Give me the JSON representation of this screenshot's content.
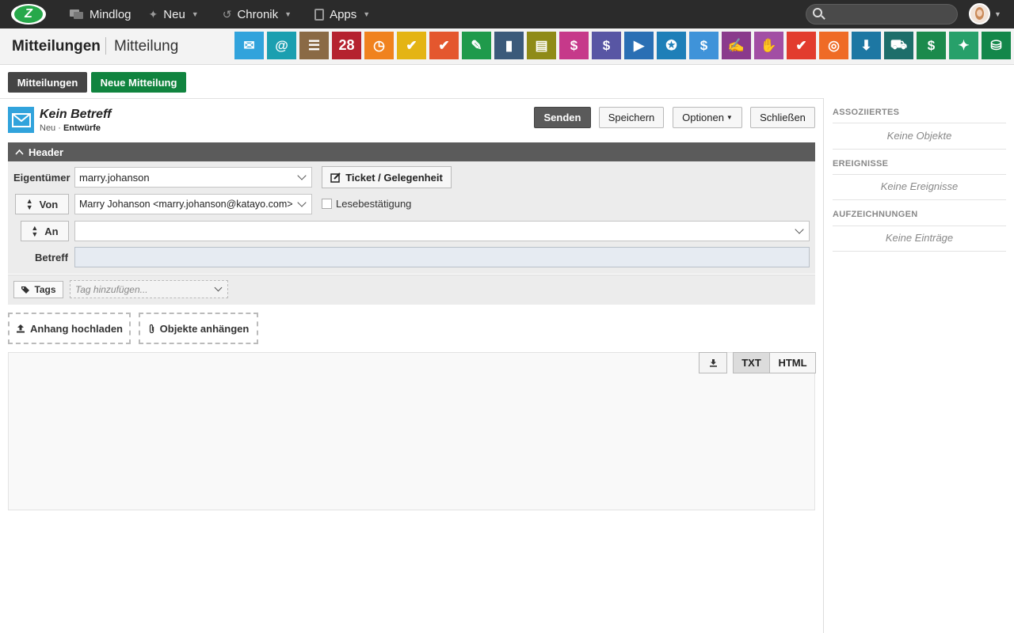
{
  "topnav": {
    "items": [
      {
        "label": "Mindlog",
        "icon": "chat-icon"
      },
      {
        "label": "Neu",
        "icon": "sparkle-icon"
      },
      {
        "label": "Chronik",
        "icon": "history-icon"
      },
      {
        "label": "Apps",
        "icon": "tablet-icon"
      }
    ],
    "search_placeholder": ""
  },
  "page": {
    "title": "Mitteilungen",
    "subtitle": "Mitteilung"
  },
  "app_icons": [
    {
      "name": "mail-app-icon",
      "color": "#31a3dc",
      "glyph": "✉"
    },
    {
      "name": "email-app-icon",
      "color": "#1b9fb0",
      "glyph": "@"
    },
    {
      "name": "contacts-app-icon",
      "color": "#8a6a45",
      "glyph": "☰"
    },
    {
      "name": "calendar-app-icon",
      "color": "#b5222f",
      "glyph": "28"
    },
    {
      "name": "timer-app-icon",
      "color": "#f0821e",
      "glyph": "◷"
    },
    {
      "name": "tasks-app-icon",
      "color": "#e4b414",
      "glyph": "✔"
    },
    {
      "name": "projects-app-icon",
      "color": "#e4572e",
      "glyph": "✔"
    },
    {
      "name": "notes-app-icon",
      "color": "#1f9a4b",
      "glyph": "✎"
    },
    {
      "name": "bookmarks-app-icon",
      "color": "#3b5a7a",
      "glyph": "▮"
    },
    {
      "name": "documents-app-icon",
      "color": "#8f8b17",
      "glyph": "▤"
    },
    {
      "name": "helpdesk-app-icon",
      "color": "#c6398a",
      "glyph": "$"
    },
    {
      "name": "finance-app-icon",
      "color": "#5856a4",
      "glyph": "$"
    },
    {
      "name": "delivery-app-icon",
      "color": "#2a6fb4",
      "glyph": "▶"
    },
    {
      "name": "support-app-icon",
      "color": "#1e7fb8",
      "glyph": "✪"
    },
    {
      "name": "budget-app-icon",
      "color": "#3f93d9",
      "glyph": "$"
    },
    {
      "name": "contracts-app-icon",
      "color": "#8a3a8c",
      "glyph": "✍"
    },
    {
      "name": "deals-app-icon",
      "color": "#a24ea4",
      "glyph": "✋"
    },
    {
      "name": "invoices-app-icon",
      "color": "#e23c2e",
      "glyph": "✔"
    },
    {
      "name": "campaign-app-icon",
      "color": "#ef6b26",
      "glyph": "◎"
    },
    {
      "name": "downloads-app-icon",
      "color": "#1d77a3",
      "glyph": "⬇"
    },
    {
      "name": "shop-app-icon",
      "color": "#1d6e6a",
      "glyph": "⛟"
    },
    {
      "name": "payments-app-icon",
      "color": "#1b8a4c",
      "glyph": "$"
    },
    {
      "name": "pricing-app-icon",
      "color": "#27a06a",
      "glyph": "✦"
    },
    {
      "name": "database-app-icon",
      "color": "#13874a",
      "glyph": "⛁"
    }
  ],
  "tabs": {
    "messages": "Mitteilungen",
    "new_message": "Neue Mitteilung"
  },
  "message": {
    "title": "Kein Betreff",
    "status_prefix": "Neu ·",
    "status_folder": "Entwürfe",
    "send": "Senden",
    "save": "Speichern",
    "options": "Optionen",
    "close": "Schließen"
  },
  "header_section": {
    "title": "Header",
    "owner_label": "Eigentümer",
    "owner_value": "marry.johanson",
    "ticket_button": "Ticket / Gelegenheit",
    "from_label": "Von",
    "from_value": "Marry Johanson <marry.johanson@katayo.com>",
    "read_receipt": "Lesebestätigung",
    "read_receipt_checked": false,
    "to_label": "An",
    "to_value": "",
    "subject_label": "Betreff",
    "subject_value": ""
  },
  "tags": {
    "button": "Tags",
    "placeholder": "Tag hinzufügen..."
  },
  "attachments": {
    "upload": "Anhang hochladen",
    "attach_objects": "Objekte anhängen"
  },
  "editor": {
    "format_txt": "TXT",
    "format_html": "HTML",
    "active_format": "TXT"
  },
  "sidebar": {
    "sections": [
      {
        "title": "ASSOZIIERTES",
        "empty": "Keine Objekte"
      },
      {
        "title": "EREIGNISSE",
        "empty": "Keine Ereignisse"
      },
      {
        "title": "AUFZEICHNUNGEN",
        "empty": "Keine Einträge"
      }
    ]
  }
}
